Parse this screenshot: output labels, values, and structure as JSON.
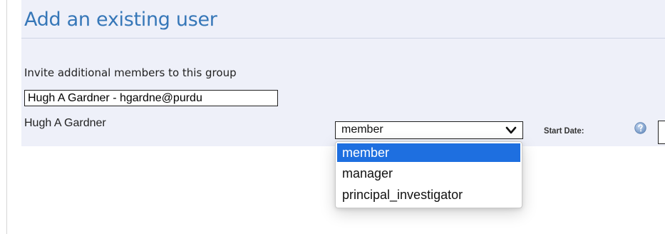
{
  "header": {
    "title": "Add an existing user"
  },
  "invite": {
    "label": "Invite additional members to this group",
    "input_value": "Hugh A Gardner - hgardne@purdu"
  },
  "user": {
    "name": "Hugh A Gardner"
  },
  "role_select": {
    "selected_value": "member",
    "options": [
      "member",
      "manager",
      "principal_investigator"
    ],
    "highlighted_index": 0
  },
  "start_date": {
    "label": "Start Date:",
    "value": ""
  },
  "icons": {
    "help": "help-icon",
    "chevron": "chevron-down-icon"
  },
  "colors": {
    "title": "#3677b8",
    "panel_background": "#eef0f9",
    "option_highlight": "#1e6fe0"
  }
}
